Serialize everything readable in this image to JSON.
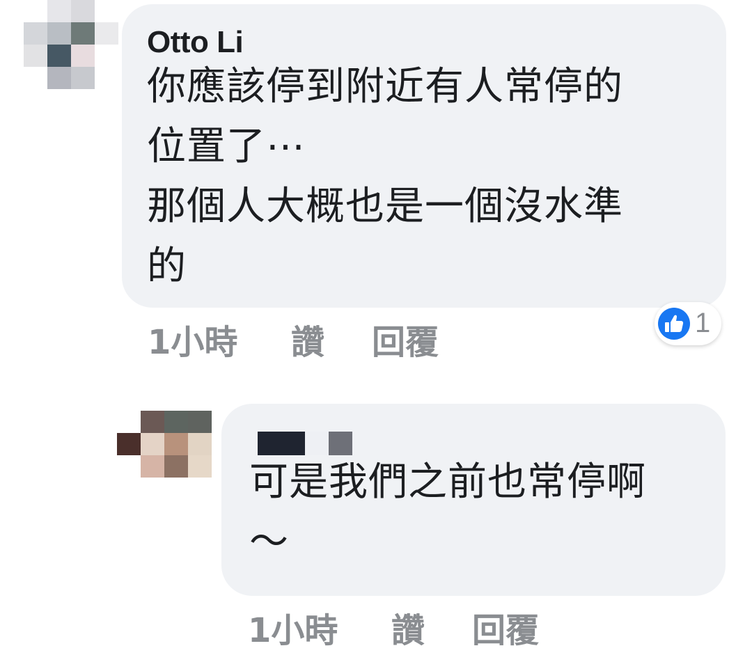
{
  "comments": [
    {
      "author": "Otto Li",
      "text": "你應該停到附近有人常停的\n位置了⋯\n那個人大概也是一個沒水準\n的",
      "time": "1小時",
      "like_label": "讚",
      "reply_label": "回覆",
      "reactions": {
        "icon": "thumbs-up-icon",
        "count": "1",
        "color": "#1877f2"
      }
    },
    {
      "author_redacted": true,
      "text": "可是我們之前也常停啊\n～",
      "time": "1小時",
      "like_label": "讚",
      "reply_label": "回覆"
    }
  ],
  "colors": {
    "bubble": "#f0f2f5",
    "text": "#1c1e21",
    "meta": "#8a8d91",
    "like_blue": "#1877f2"
  }
}
